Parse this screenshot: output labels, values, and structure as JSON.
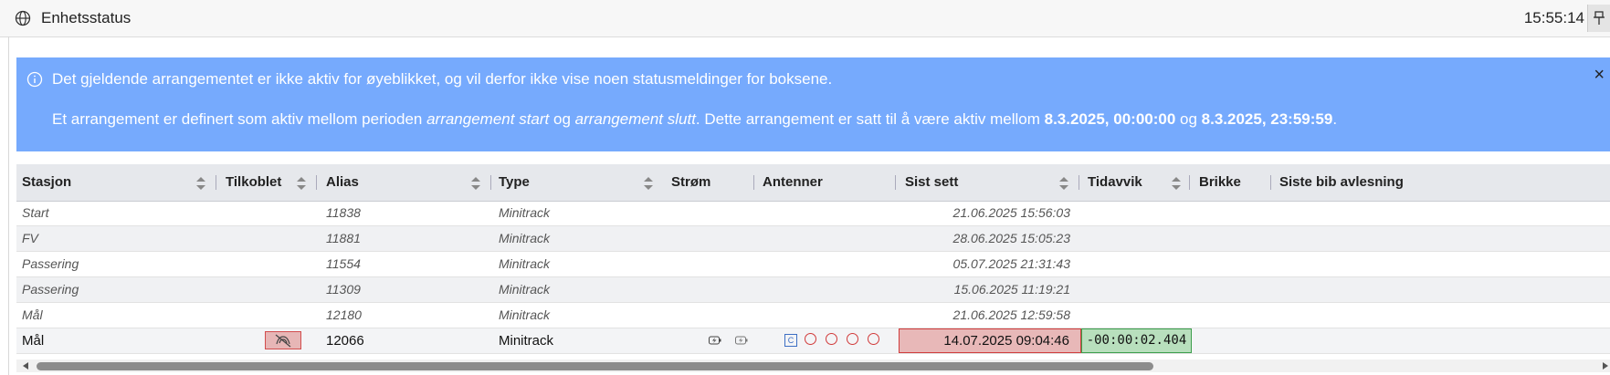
{
  "window": {
    "title": "Enhetsstatus",
    "clock": "15:55:14"
  },
  "banner": {
    "line1": "Det gjeldende arrangementet er ikke aktiv for øyeblikket, og vil derfor ikke vise noen statusmeldinger for boksene.",
    "line2_pre": "Et arrangement er definert som aktiv mellom perioden ",
    "line2_em1": "arrangement start",
    "line2_mid1": " og ",
    "line2_em2": "arrangement slutt",
    "line2_mid2": ". Dette arrangement er satt til å være aktiv mellom ",
    "line2_b1": "8.3.2025, 00:00:00",
    "line2_mid3": " og ",
    "line2_b2": "8.3.2025, 23:59:59",
    "line2_end": ".",
    "close": "×",
    "color": "#76aafd"
  },
  "table": {
    "headers": {
      "stasjon": "Stasjon",
      "tilkoblet": "Tilkoblet",
      "alias": "Alias",
      "type": "Type",
      "strom": "Strøm",
      "antenner": "Antenner",
      "sist_sett": "Sist sett",
      "tidavvik": "Tidavvik",
      "brikke": "Brikke",
      "siste_bib": "Siste bib avlesning"
    },
    "rows": [
      {
        "stasjon": "Start",
        "alias": "11838",
        "type": "Minitrack",
        "sist_sett": "21.06.2025 15:56:03"
      },
      {
        "stasjon": "FV",
        "alias": "11881",
        "type": "Minitrack",
        "sist_sett": "28.06.2025 15:05:23"
      },
      {
        "stasjon": "Passering",
        "alias": "11554",
        "type": "Minitrack",
        "sist_sett": "05.07.2025 21:31:43"
      },
      {
        "stasjon": "Passering",
        "alias": "11309",
        "type": "Minitrack",
        "sist_sett": "15.06.2025 11:19:21"
      },
      {
        "stasjon": "Mål",
        "alias": "12180",
        "type": "Minitrack",
        "sist_sett": "21.06.2025 12:59:58"
      },
      {
        "stasjon": "Mål",
        "alias": "12066",
        "type": "Minitrack",
        "sist_sett": "14.07.2025 09:04:46",
        "tidavvik": "-00:00:02.404",
        "antenne_label": "C",
        "connected": false
      }
    ]
  },
  "icons": {
    "globe": "globe-icon",
    "info": "info-icon",
    "pin": "pin-icon",
    "disconnected": "no-signal-icon",
    "power": "battery-charging-icon"
  },
  "colors": {
    "error_bg": "#e8b8b8",
    "error_border": "#d03c3c",
    "ok_bg": "#b8dfbd",
    "ok_border": "#3c9e4c",
    "antenna_ring": "#d13a3a"
  }
}
